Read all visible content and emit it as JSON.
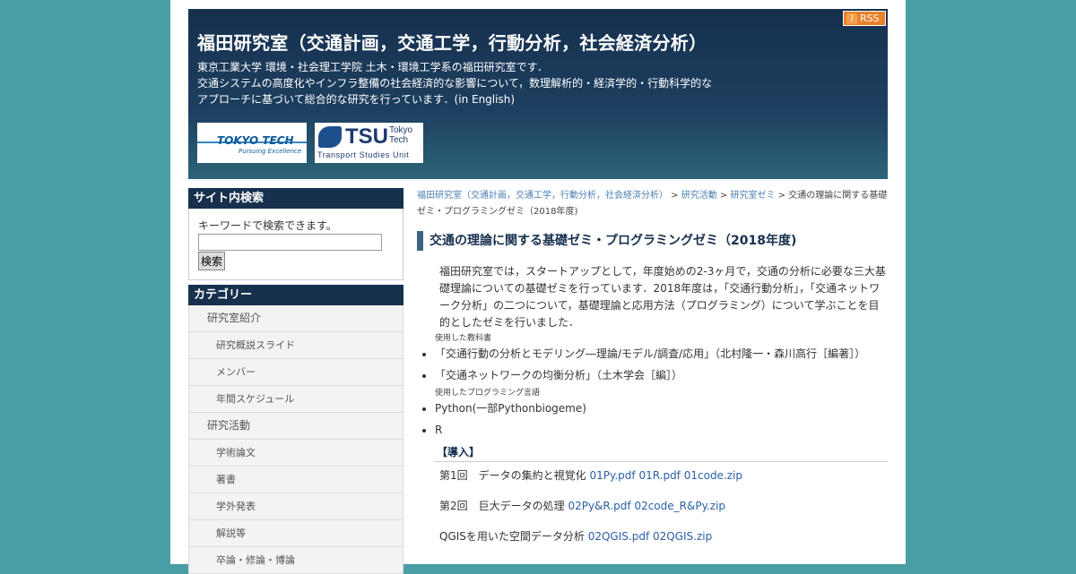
{
  "header": {
    "rss_label": "RSS",
    "title": "福田研究室（交通計画，交通工学，行動分析，社会経済分析）",
    "desc_lines": [
      "東京工業大学 環境・社会理工学院 土木・環境工学系の福田研究室です．",
      "交通システムの高度化やインフラ整備の社会経済的な影響について，数理解析的・経済学的・行動科学的な",
      "アプローチに基づいて総合的な研究を行っています．(in English)"
    ],
    "logo_tokyotech": {
      "main": "TOKYO TECH",
      "tagline": "Pursuing Excellence"
    },
    "logo_tsu": {
      "big": "TSU",
      "small1": "Tokyo",
      "small2": "Tech",
      "sub": "Transport Studies Unit"
    }
  },
  "sidebar": {
    "search_title": "サイト内検索",
    "search_label": "キーワードで検索できます。",
    "search_button": "検索",
    "category_title": "カテゴリー",
    "categories": [
      {
        "label": "研究室紹介",
        "level": 1
      },
      {
        "label": "研究概説スライド",
        "level": 2
      },
      {
        "label": "メンバー",
        "level": 2
      },
      {
        "label": "年間スケジュール",
        "level": 2
      },
      {
        "label": "研究活動",
        "level": 1
      },
      {
        "label": "学術論文",
        "level": 2
      },
      {
        "label": "著書",
        "level": 2
      },
      {
        "label": "学外発表",
        "level": 2
      },
      {
        "label": "解説等",
        "level": 2
      },
      {
        "label": "卒論・修論・博論",
        "level": 2
      }
    ]
  },
  "main": {
    "breadcrumb": {
      "link1": "福田研究室（交通計画，交通工学，行動分析，社会経済分析）",
      "sep": " > ",
      "link2": "研究活動",
      "link3": "研究室ゼミ",
      "current": "交通の理論に関する基礎ゼミ・プログラミングゼミ（2018年度)"
    },
    "title": "交通の理論に関する基礎ゼミ・プログラミングゼミ（2018年度)",
    "intro": "福田研究室では，スタートアップとして，年度始めの2-3ヶ月で，交通の分析に必要な三大基礎理論についての基礎ゼミを行っています．2018年度は，「交通行動分析」，「交通ネットワーク分析」の二つについて，基礎理論と応用方法（プログラミング）について学ぶことを目的としたゼミを行いました．",
    "textbooks_label": "使用した教科書",
    "textbooks": [
      "「交通行動の分析とモデリング―理論/モデル/調査/応用」（北村隆一・森川高行［編著］）",
      "「交通ネットワークの均衡分析」（土木学会［編］）"
    ],
    "languages_label": "使用したプログラミング言語",
    "languages": [
      "Python(一部Pythonbiogeme)",
      "R"
    ],
    "section_title": "【導入】",
    "sessions": [
      {
        "text": "第1回　データの集約と視覚化 ",
        "files": [
          "01Py.pdf",
          "01R.pdf",
          "01code.zip"
        ]
      },
      {
        "text": "第2回　巨大データの処理 ",
        "files": [
          "02Py&R.pdf",
          "02code_R&Py.zip"
        ]
      },
      {
        "text": "QGISを用いた空間データ分析 ",
        "files": [
          "02QGIS.pdf",
          "02QGIS.zip"
        ]
      }
    ]
  }
}
